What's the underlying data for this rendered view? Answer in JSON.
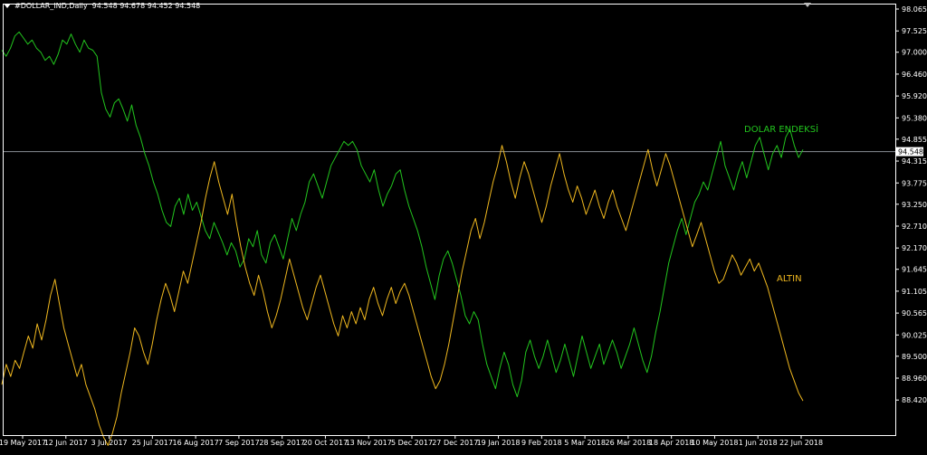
{
  "header": {
    "symbol": "#DOLLAR_IND,Daily",
    "ohlc": "94.548 94.678 94.452 94.548"
  },
  "colors": {
    "background": "#000000",
    "dollar_line": "#22c51e",
    "gold_line": "#f0b81f",
    "axis": "#ffffff",
    "hline": "#8a8f96"
  },
  "chart_data": {
    "type": "line",
    "title": "",
    "xlabel": "",
    "ylabel": "",
    "ylim": [
      88.135,
      98.065
    ],
    "y_ticks": [
      "98.065",
      "97.525",
      "97.000",
      "96.460",
      "95.920",
      "95.380",
      "94.855",
      "94.315",
      "93.775",
      "93.250",
      "92.710",
      "92.170",
      "91.645",
      "91.105",
      "90.565",
      "90.025",
      "89.500",
      "88.960",
      "88.420"
    ],
    "x_ticks": [
      "19 May 2017",
      "12 Jun 2017",
      "3 Jul 2017",
      "25 Jul 2017",
      "16 Aug 2017",
      "7 Sep 2017",
      "28 Sep 2017",
      "20 Oct 2017",
      "13 Nov 2017",
      "5 Dec 2017",
      "27 Dec 2017",
      "19 Jan 2018",
      "9 Feb 2018",
      "5 Mar 2018",
      "26 Mar 2018",
      "18 Apr 2018",
      "10 May 2018",
      "1 Jun 2018",
      "22 Jun 2018"
    ],
    "current_price": {
      "value": 94.548,
      "label": "94.548"
    },
    "annotations": [
      {
        "text": "DOLAR ENDEKSİ",
        "series": "dollar"
      },
      {
        "text": "ALTIN",
        "series": "gold"
      }
    ],
    "grid": false,
    "series": [
      {
        "key": "dollar",
        "values": [
          97.05,
          96.9,
          97.1,
          97.4,
          97.5,
          97.35,
          97.2,
          97.3,
          97.1,
          97.0,
          96.8,
          96.9,
          96.7,
          96.95,
          97.3,
          97.2,
          97.45,
          97.2,
          97.0,
          97.3,
          97.1,
          97.05,
          96.9,
          96.0,
          95.6,
          95.4,
          95.75,
          95.85,
          95.6,
          95.3,
          95.7,
          95.2,
          94.9,
          94.5,
          94.2,
          93.8,
          93.5,
          93.1,
          92.8,
          92.7,
          93.2,
          93.4,
          93.0,
          93.5,
          93.1,
          93.3,
          92.95,
          92.6,
          92.4,
          92.8,
          92.55,
          92.3,
          92.0,
          92.3,
          92.1,
          91.7,
          91.9,
          92.4,
          92.2,
          92.6,
          92.0,
          91.8,
          92.3,
          92.5,
          92.2,
          91.9,
          92.4,
          92.9,
          92.6,
          93.0,
          93.3,
          93.8,
          94.0,
          93.7,
          93.4,
          93.8,
          94.2,
          94.4,
          94.6,
          94.8,
          94.7,
          94.8,
          94.6,
          94.2,
          94.0,
          93.8,
          94.1,
          93.6,
          93.2,
          93.5,
          93.7,
          94.0,
          94.1,
          93.6,
          93.2,
          92.9,
          92.6,
          92.2,
          91.7,
          91.3,
          90.9,
          91.5,
          91.9,
          92.1,
          91.8,
          91.4,
          91.0,
          90.5,
          90.3,
          90.6,
          90.4,
          89.8,
          89.3,
          89.0,
          88.7,
          89.2,
          89.6,
          89.3,
          88.8,
          88.5,
          88.9,
          89.6,
          89.9,
          89.5,
          89.2,
          89.5,
          89.9,
          89.5,
          89.1,
          89.4,
          89.8,
          89.4,
          89.0,
          89.5,
          90.0,
          89.6,
          89.2,
          89.5,
          89.8,
          89.3,
          89.6,
          89.9,
          89.6,
          89.2,
          89.5,
          89.8,
          90.2,
          89.8,
          89.4,
          89.1,
          89.5,
          90.1,
          90.6,
          91.2,
          91.8,
          92.2,
          92.6,
          92.9,
          92.5,
          92.9,
          93.3,
          93.5,
          93.8,
          93.6,
          94.0,
          94.4,
          94.8,
          94.2,
          93.9,
          93.6,
          94.0,
          94.3,
          93.9,
          94.3,
          94.7,
          94.9,
          94.5,
          94.1,
          94.5,
          94.7,
          94.4,
          94.9,
          95.1,
          94.7,
          94.4,
          94.6
        ]
      },
      {
        "key": "gold",
        "values": [
          88.8,
          89.3,
          89.0,
          89.4,
          89.2,
          89.6,
          90.0,
          89.7,
          90.3,
          89.9,
          90.4,
          91.0,
          91.4,
          90.8,
          90.2,
          89.8,
          89.4,
          89.0,
          89.3,
          88.8,
          88.5,
          88.2,
          87.8,
          87.5,
          87.3,
          87.6,
          88.0,
          88.6,
          89.1,
          89.6,
          90.2,
          90.0,
          89.6,
          89.3,
          89.8,
          90.4,
          90.9,
          91.3,
          91.0,
          90.6,
          91.1,
          91.6,
          91.3,
          91.8,
          92.3,
          92.8,
          93.4,
          93.9,
          94.3,
          93.8,
          93.4,
          93.0,
          93.5,
          92.8,
          92.2,
          91.7,
          91.3,
          91.0,
          91.5,
          91.1,
          90.6,
          90.2,
          90.5,
          90.9,
          91.4,
          91.9,
          91.5,
          91.1,
          90.7,
          90.4,
          90.8,
          91.2,
          91.5,
          91.1,
          90.7,
          90.3,
          90.0,
          90.5,
          90.2,
          90.6,
          90.3,
          90.7,
          90.4,
          90.9,
          91.2,
          90.8,
          90.5,
          90.9,
          91.2,
          90.8,
          91.1,
          91.3,
          91.0,
          90.6,
          90.2,
          89.8,
          89.4,
          89.0,
          88.7,
          88.9,
          89.3,
          89.8,
          90.4,
          91.0,
          91.6,
          92.1,
          92.6,
          92.9,
          92.4,
          92.8,
          93.3,
          93.8,
          94.2,
          94.7,
          94.3,
          93.8,
          93.4,
          93.9,
          94.3,
          94.0,
          93.6,
          93.2,
          92.8,
          93.2,
          93.7,
          94.1,
          94.5,
          94.0,
          93.6,
          93.3,
          93.7,
          93.4,
          93.0,
          93.3,
          93.6,
          93.2,
          92.9,
          93.3,
          93.6,
          93.2,
          92.9,
          92.6,
          93.0,
          93.4,
          93.8,
          94.2,
          94.6,
          94.1,
          93.7,
          94.1,
          94.5,
          94.2,
          93.8,
          93.4,
          93.0,
          92.6,
          92.2,
          92.5,
          92.8,
          92.4,
          92.0,
          91.6,
          91.3,
          91.4,
          91.7,
          92.0,
          91.8,
          91.5,
          91.7,
          91.9,
          91.6,
          91.8,
          91.5,
          91.2,
          90.8,
          90.4,
          90.0,
          89.6,
          89.2,
          88.9,
          88.6,
          88.4
        ]
      }
    ]
  }
}
